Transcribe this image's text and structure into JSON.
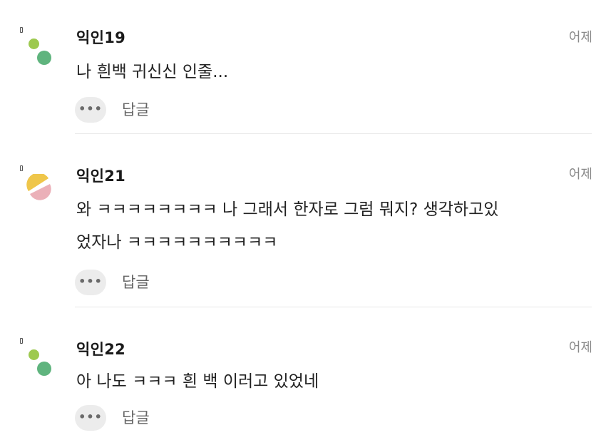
{
  "comments": [
    {
      "nickname": "익인19",
      "time": "어제",
      "lines": [
        "나 흰백 귀신신 인줄..."
      ],
      "more_label": "•••",
      "reply_label": "답글",
      "avatar": {
        "icon": "dots-avatar-icon",
        "colors": [
          "#9dc94f",
          "#5fb47e"
        ]
      }
    },
    {
      "nickname": "익인21",
      "time": "어제",
      "lines": [
        "와 ㅋㅋㅋㅋㅋㅋㅋㅋ 나 그래서 한자로 그럼 뭐지? 생각하고있",
        "었자나 ㅋㅋㅋㅋㅋㅋㅋㅋㅋㅋ"
      ],
      "more_label": "•••",
      "reply_label": "답글",
      "avatar": {
        "icon": "half-circles-avatar-icon",
        "colors": [
          "#efc64a",
          "#ebb0b8"
        ]
      }
    },
    {
      "nickname": "익인22",
      "time": "어제",
      "lines": [
        "아 나도 ㅋㅋㅋ 흰 백 이러고 있었네"
      ],
      "more_label": "•••",
      "reply_label": "답글",
      "avatar": {
        "icon": "dots-avatar-icon",
        "colors": [
          "#9dc94f",
          "#5fb47e"
        ]
      }
    }
  ]
}
